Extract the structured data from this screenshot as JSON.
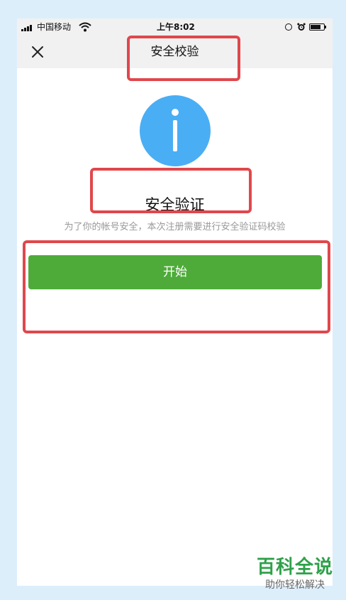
{
  "status_bar": {
    "carrier": "中国移动",
    "time": "上午8:02",
    "battery_level": 0.85,
    "icons": [
      "signal-icon",
      "wifi-icon",
      "rotation-lock-icon",
      "alarm-icon",
      "battery-icon"
    ]
  },
  "nav": {
    "close_icon": "close-icon",
    "title": "安全校验"
  },
  "content": {
    "icon": "info-icon",
    "icon_color": "#4aaef4",
    "heading": "安全验证",
    "description": "为了你的帐号安全，本次注册需要进行安全验证码校验",
    "start_button": "开始",
    "button_color": "#4eab3a"
  },
  "annotation_color": "#e0474c",
  "watermark": {
    "title": "百科全说",
    "subtitle": "助你轻松解决"
  }
}
